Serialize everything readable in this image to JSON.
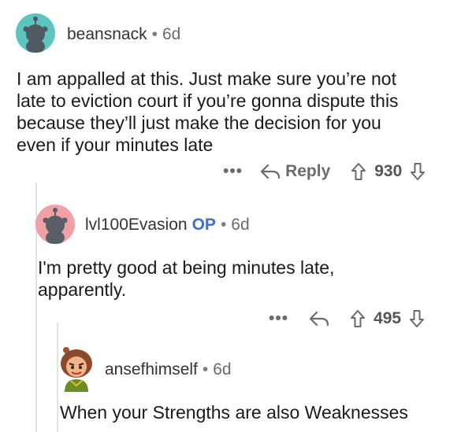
{
  "comments": [
    {
      "username": "beansnack",
      "time": "6d",
      "body": [
        "I am appalled at this. Just make sure you’re not",
        "late to eviction court if you’re gonna dispute this",
        "because they’ll just make the decision for you",
        "even if your minutes late"
      ],
      "more": "•••",
      "reply_label": "Reply",
      "votes": "930",
      "avatar_color": "#5ec4c0"
    },
    {
      "username": "lvl100Evasion",
      "op_badge": "OP",
      "time": "6d",
      "body": [
        "I'm pretty good at being minutes late,",
        "apparently."
      ],
      "more": "•••",
      "votes": "495",
      "avatar_color": "#f0a1a8"
    },
    {
      "username": "ansefhimself",
      "time": "6d",
      "body": [
        "When your Strengths are also Weaknesses"
      ]
    }
  ],
  "separator": "•",
  "colors": {
    "op_badge": "#3a6fd6",
    "meta_gray": "#6b6b6b",
    "thread_line": "#e3e3e3"
  }
}
